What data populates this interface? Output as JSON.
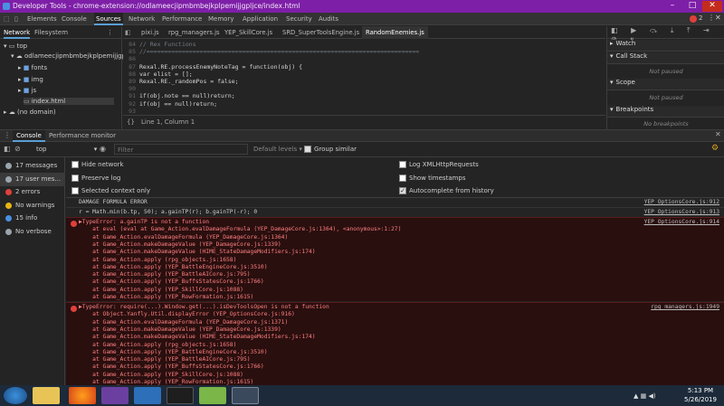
{
  "window": {
    "title": "Developer Tools - chrome-extension://odlameecjipmbmbejkplpemijjgpljce/index.html",
    "minimize": "–",
    "maximize": "□",
    "close": "✕"
  },
  "devtools_tabs": [
    "Elements",
    "Console",
    "Sources",
    "Network",
    "Performance",
    "Memory",
    "Application",
    "Security",
    "Audits"
  ],
  "error_count": "2",
  "navigator": {
    "tabs": [
      "Network",
      "Filesystem"
    ],
    "tree": [
      "top",
      "odlameecjipmbmbejkplpemijjgplj",
      "fonts",
      "img",
      "js",
      "index.html",
      "(no domain)"
    ]
  },
  "editor": {
    "file_tabs": [
      "pixi.js",
      "rpg_managers.js",
      "YEP_SkillCore.js",
      "SRD_SuperToolsEngine.js",
      "RandomEnemies.js"
    ],
    "line_numbers": [
      "84",
      "85",
      "86",
      "87",
      "88",
      "89",
      "90",
      "91",
      "92",
      "93"
    ],
    "lines": [
      "// Rex Functions",
      "//=============================================================================",
      "",
      "Rexal.RE.processEnemyNoteTag = function(obj) {",
      "var elist = [];",
      "Rexal.RE._randomPos = false;",
      "",
      "if(obj.note == null)return;",
      "if(obj == null)return;",
      ""
    ],
    "status": "Line 1, Column 1",
    "braces": "{}"
  },
  "debugger": {
    "sections": [
      "Watch",
      "Call Stack",
      "Scope",
      "Breakpoints"
    ],
    "not_paused": "Not paused",
    "no_breakpoints": "No breakpoints"
  },
  "drawer": {
    "tabs": [
      "Console",
      "Performance monitor"
    ]
  },
  "console_toolbar": {
    "context": "top",
    "filter_placeholder": "Filter",
    "levels": "Default levels ▾",
    "group_similar": "Group similar"
  },
  "console_sidebar": [
    {
      "label": "17 messages",
      "color": "#9aa4ad"
    },
    {
      "label": "17 user mes...",
      "color": "#9aa4ad"
    },
    {
      "label": "2 errors",
      "color": "#e0403c"
    },
    {
      "label": "No warnings",
      "color": "#e7b416"
    },
    {
      "label": "15 info",
      "color": "#4a90e2"
    },
    {
      "label": "No verbose",
      "color": "#9aa4ad"
    }
  ],
  "console_settings": {
    "left": [
      {
        "label": "Hide network",
        "checked": false
      },
      {
        "label": "Preserve log",
        "checked": false
      },
      {
        "label": "Selected context only",
        "checked": false
      }
    ],
    "right": [
      {
        "label": "Log XMLHttpRequests",
        "checked": false
      },
      {
        "label": "Show timestamps",
        "checked": false
      },
      {
        "label": "Autocomplete from history",
        "checked": true
      }
    ]
  },
  "messages": {
    "m1": {
      "text": "DAMAGE FORMULA ERROR",
      "source": "YEP_OptionsCore.js:912"
    },
    "m2": {
      "text": "r = Math.min(b.tp, 50); a.gainTP(r); b.gainTP(-r); 0",
      "source": "YEP_OptionsCore.js:913"
    },
    "e1": {
      "source": "YEP_OptionsCore.js:914",
      "lines": [
        "▶TypeError: a.gainTP is not a function",
        "    at eval (eval at Game_Action.evalDamageFormula (YEP_DamageCore.js:1364), <anonymous>:1:27)",
        "    at Game_Action.evalDamageFormula (YEP_DamageCore.js:1364)",
        "    at Game_Action.makeDamageValue (YEP_DamageCore.js:1339)",
        "    at Game_Action.makeDamageValue (HIME_StateDamageModifiers.js:174)",
        "    at Game_Action.apply (rpg_objects.js:1658)",
        "    at Game_Action.apply (YEP_BattleEngineCore.js:3510)",
        "    at Game_Action.apply (YEP_BattleAICore.js:795)",
        "    at Game_Action.apply (YEP_BuffsStatesCore.js:1766)",
        "    at Game_Action.apply (YEP_SkillCore.js:1088)",
        "    at Game_Action.apply (YEP_RowFormation.js:1615)"
      ]
    },
    "e2": {
      "source": "rpg_managers.js:1949",
      "lines": [
        "▶TypeError: require(...).Window.get(...).isDevToolsOpen is not a function",
        "    at Object.Yanfly.Util.displayError (YEP_OptionsCore.js:916)",
        "    at Game_Action.evalDamageFormula (YEP_DamageCore.js:1371)",
        "    at Game_Action.makeDamageValue (YEP_DamageCore.js:1339)",
        "    at Game_Action.makeDamageValue (HIME_StateDamageModifiers.js:174)",
        "    at Game_Action.apply (rpg_objects.js:1658)",
        "    at Game_Action.apply (YEP_BattleEngineCore.js:3510)",
        "    at Game_Action.apply (YEP_BattleAICore.js:795)",
        "    at Game_Action.apply (YEP_BuffsStatesCore.js:1766)",
        "    at Game_Action.apply (YEP_SkillCore.js:1088)",
        "    at Game_Action.apply (YEP_RowFormation.js:1615)"
      ]
    }
  },
  "taskbar": {
    "time": "5:13 PM",
    "date": "5/26/2019",
    "apps": [
      "start-button",
      "file-explorer",
      "firefox",
      "visual-studio",
      "calendar-app",
      "media-player",
      "rpg-maker",
      "game-window"
    ]
  }
}
